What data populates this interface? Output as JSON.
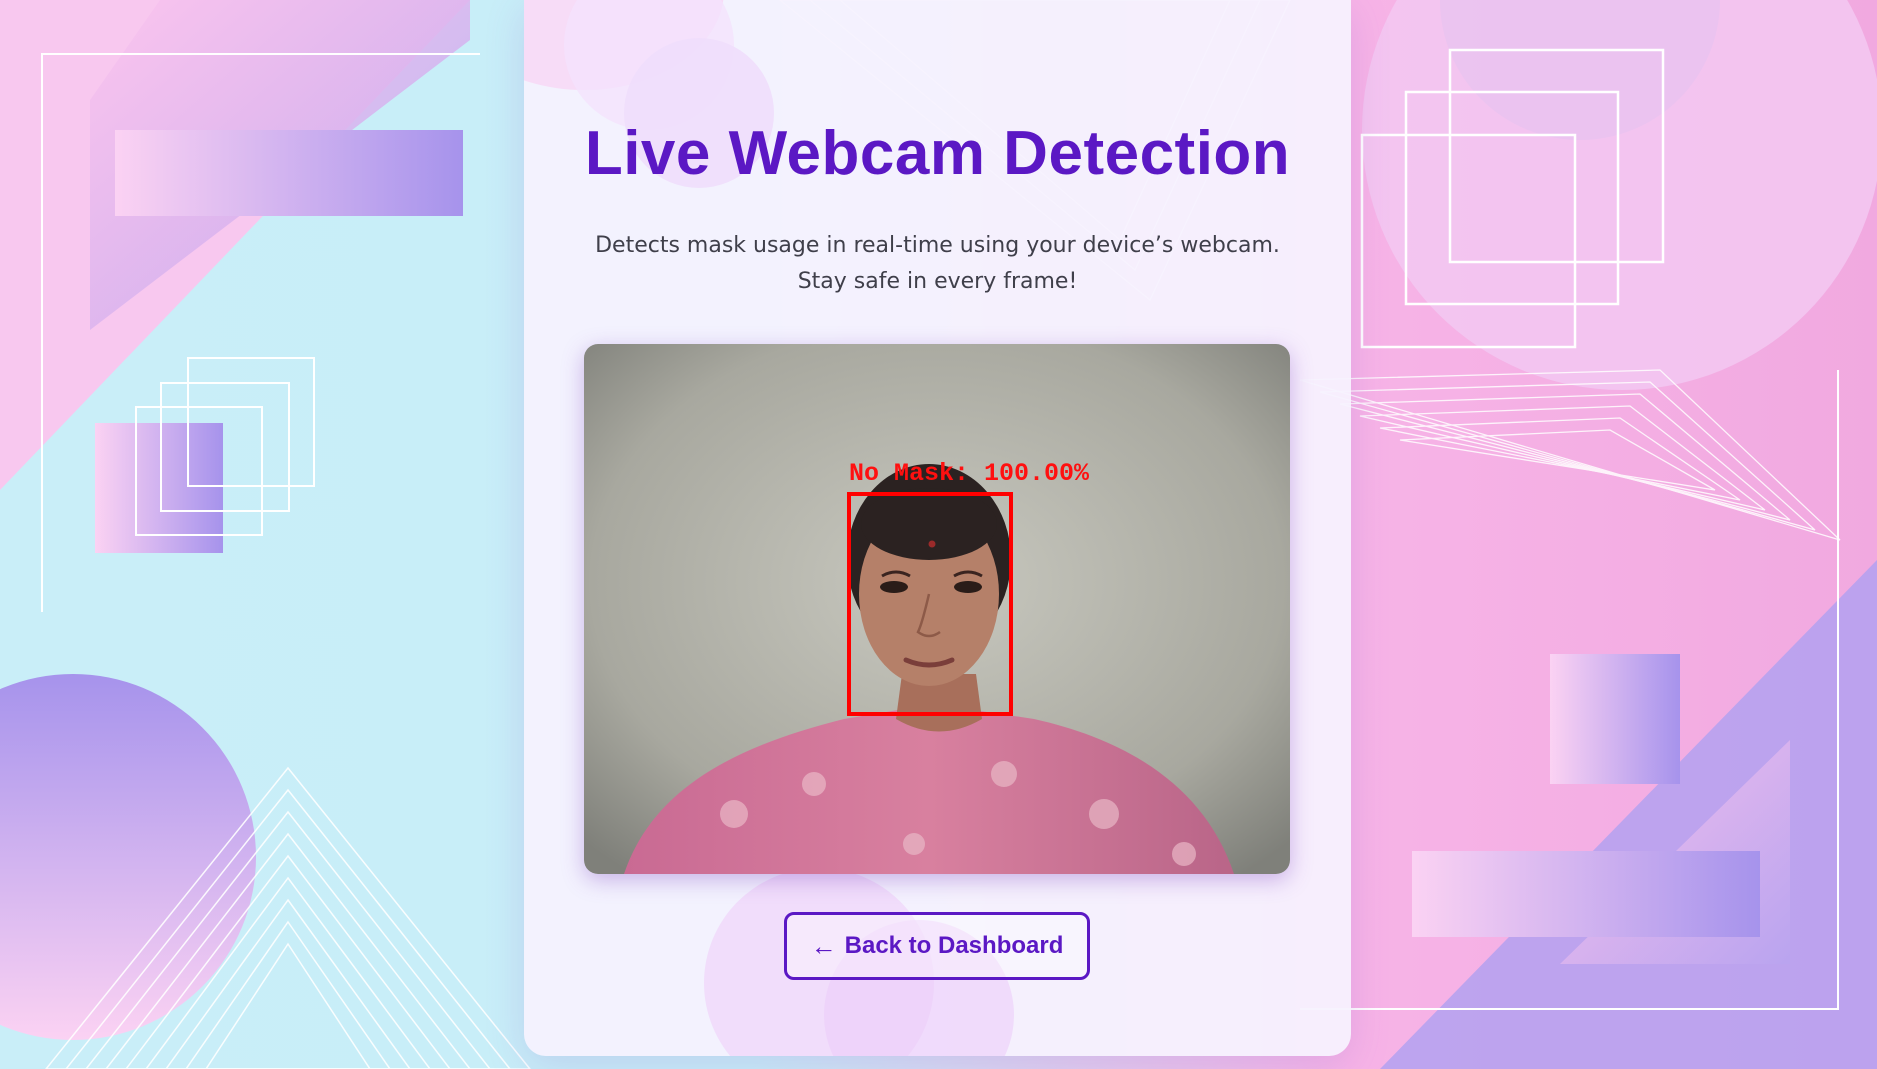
{
  "page": {
    "title": "Live Webcam Detection",
    "description_line1": "Detects mask usage in real-time using your device’s webcam.",
    "description_line2": "Stay safe in every frame!"
  },
  "webcam": {
    "detection_label": "No Mask: 100.00%",
    "box_color": "#ff0000"
  },
  "actions": {
    "back_icon": "arrow-left-icon",
    "back_label": "Back to Dashboard"
  },
  "colors": {
    "accent": "#5b18c4",
    "text": "#3f3f4a"
  }
}
